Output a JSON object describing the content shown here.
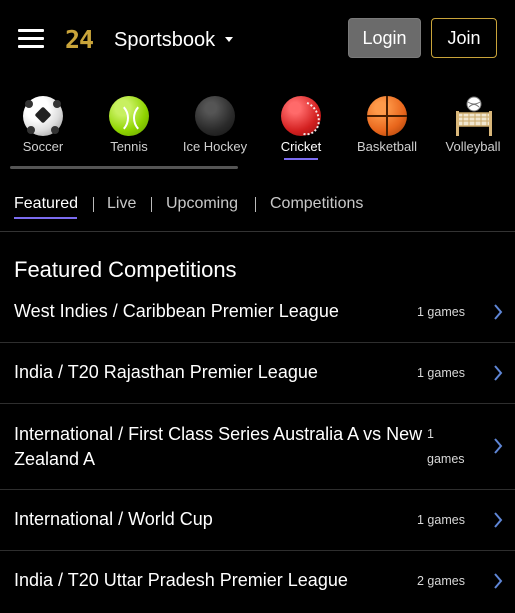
{
  "header": {
    "logo": "24",
    "brand": "Sportsbook",
    "login_label": "Login",
    "join_label": "Join"
  },
  "sports": [
    {
      "label": "Soccer",
      "icon": "soccer-ball-icon"
    },
    {
      "label": "Tennis",
      "icon": "tennis-ball-icon"
    },
    {
      "label": "Ice Hockey",
      "icon": "hockey-puck-icon"
    },
    {
      "label": "Cricket",
      "icon": "cricket-ball-icon",
      "active": true
    },
    {
      "label": "Basketball",
      "icon": "basketball-icon"
    },
    {
      "label": "Volleyball",
      "icon": "volleyball-net-icon"
    }
  ],
  "tabs": [
    {
      "label": "Featured",
      "active": true
    },
    {
      "label": "Live"
    },
    {
      "label": "Upcoming"
    },
    {
      "label": "Competitions"
    }
  ],
  "featured": {
    "title": "Featured Competitions",
    "rows": [
      {
        "name": "West Indies / Caribbean Premier League",
        "count": "1 games"
      },
      {
        "name": "India / T20 Rajasthan Premier League",
        "count": "1 games"
      },
      {
        "name_line1": "International / First Class Series Australia A vs New",
        "name_line2": "Zealand A",
        "count_line1": "1",
        "count_line2": "games"
      },
      {
        "name": "International / World Cup",
        "count": "1 games"
      },
      {
        "name": "India / T20 Uttar Pradesh Premier League",
        "count": "2 games"
      }
    ]
  },
  "colors": {
    "background": "#000000",
    "accent_gold": "#c9a43a",
    "accent_underline": "#7b6cf0",
    "chevron": "#5f86d6",
    "login_bg": "#6b6b6b"
  }
}
